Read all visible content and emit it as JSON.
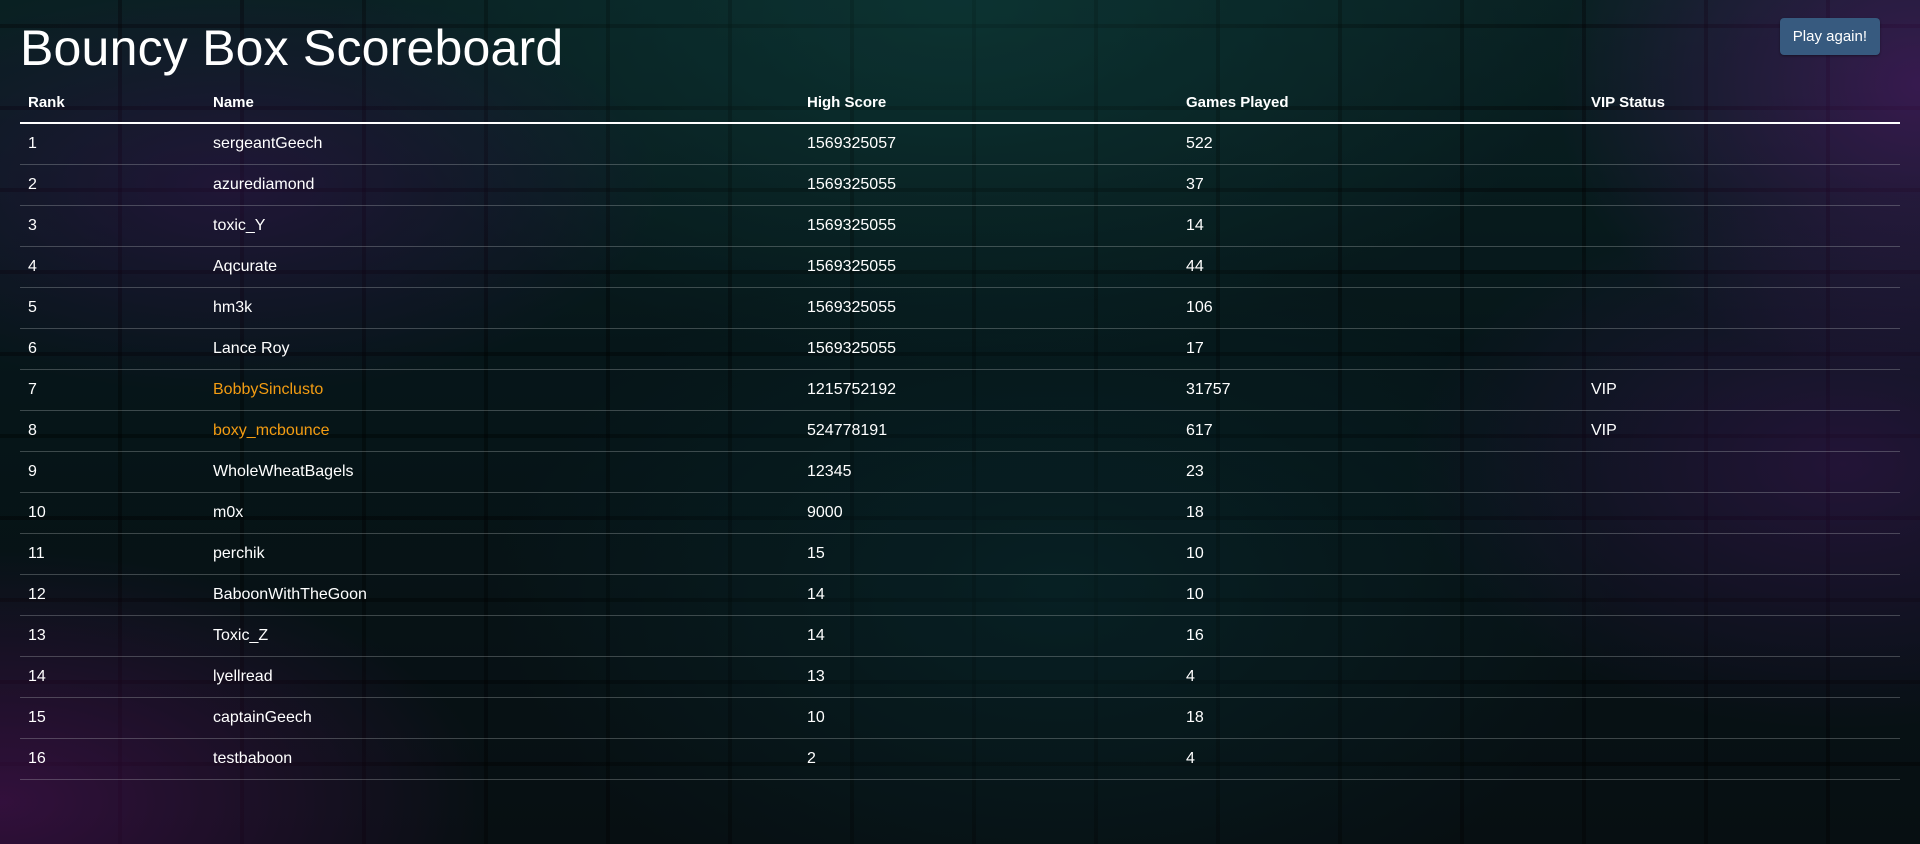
{
  "page": {
    "title": "Bouncy Box Scoreboard",
    "play_again_label": "Play again!"
  },
  "colors": {
    "button_bg": "#375a7f",
    "vip_name": "#f39c12",
    "text": "#ffffff"
  },
  "table": {
    "headers": {
      "rank": "Rank",
      "name": "Name",
      "high_score": "High Score",
      "games_played": "Games Played",
      "vip_status": "VIP Status"
    },
    "rows": [
      {
        "rank": "1",
        "name": "sergeantGeech",
        "high_score": "1569325057",
        "games_played": "522",
        "vip": ""
      },
      {
        "rank": "2",
        "name": "azurediamond",
        "high_score": "1569325055",
        "games_played": "37",
        "vip": ""
      },
      {
        "rank": "3",
        "name": "toxic_Y",
        "high_score": "1569325055",
        "games_played": "14",
        "vip": ""
      },
      {
        "rank": "4",
        "name": "Aqcurate",
        "high_score": "1569325055",
        "games_played": "44",
        "vip": ""
      },
      {
        "rank": "5",
        "name": "hm3k",
        "high_score": "1569325055",
        "games_played": "106",
        "vip": ""
      },
      {
        "rank": "6",
        "name": "Lance Roy",
        "high_score": "1569325055",
        "games_played": "17",
        "vip": ""
      },
      {
        "rank": "7",
        "name": "BobbySinclusto",
        "high_score": "1215752192",
        "games_played": "31757",
        "vip": "VIP"
      },
      {
        "rank": "8",
        "name": "boxy_mcbounce",
        "high_score": "524778191",
        "games_played": "617",
        "vip": "VIP"
      },
      {
        "rank": "9",
        "name": "WholeWheatBagels",
        "high_score": "12345",
        "games_played": "23",
        "vip": ""
      },
      {
        "rank": "10",
        "name": "m0x",
        "high_score": "9000",
        "games_played": "18",
        "vip": ""
      },
      {
        "rank": "11",
        "name": "perchik",
        "high_score": "15",
        "games_played": "10",
        "vip": ""
      },
      {
        "rank": "12",
        "name": "BaboonWithTheGoon",
        "high_score": "14",
        "games_played": "10",
        "vip": ""
      },
      {
        "rank": "13",
        "name": "Toxic_Z",
        "high_score": "14",
        "games_played": "16",
        "vip": ""
      },
      {
        "rank": "14",
        "name": "lyellread",
        "high_score": "13",
        "games_played": "4",
        "vip": ""
      },
      {
        "rank": "15",
        "name": "captainGeech",
        "high_score": "10",
        "games_played": "18",
        "vip": ""
      },
      {
        "rank": "16",
        "name": "testbaboon",
        "high_score": "2",
        "games_played": "4",
        "vip": ""
      }
    ]
  }
}
